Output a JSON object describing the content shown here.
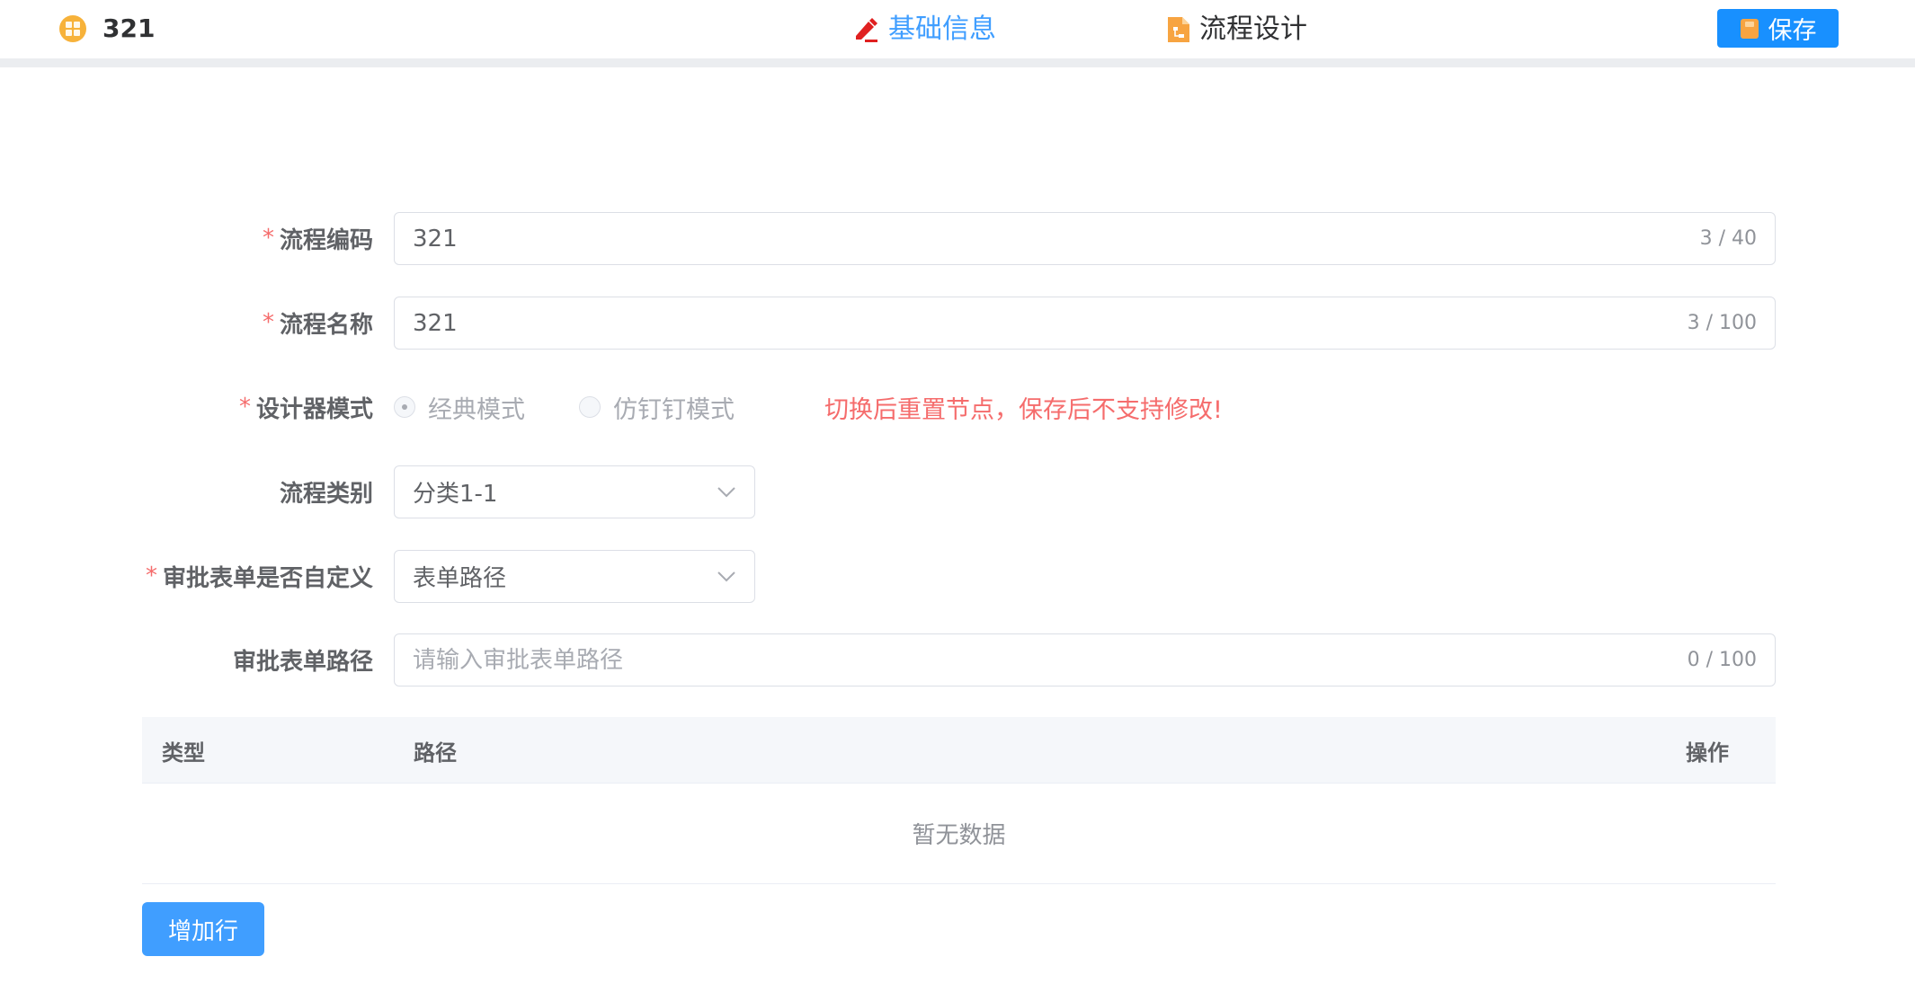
{
  "header": {
    "title": "321",
    "tabs": [
      {
        "label": "基础信息",
        "active": true,
        "icon": "edit-icon"
      },
      {
        "label": "流程设计",
        "active": false,
        "icon": "flow-doc-icon"
      }
    ],
    "save_label": "保存"
  },
  "form": {
    "code": {
      "label": "流程编码",
      "required": true,
      "value": "321",
      "counter": "3 / 40"
    },
    "name": {
      "label": "流程名称",
      "required": true,
      "value": "321",
      "counter": "3 / 100"
    },
    "mode": {
      "label": "设计器模式",
      "required": true,
      "options": [
        {
          "label": "经典模式",
          "selected": true
        },
        {
          "label": "仿钉钉模式",
          "selected": false
        }
      ],
      "warning": "切换后重置节点，保存后不支持修改!"
    },
    "category": {
      "label": "流程类别",
      "required": false,
      "value": "分类1-1"
    },
    "custom_form": {
      "label": "审批表单是否自定义",
      "required": true,
      "value": "表单路径"
    },
    "form_path": {
      "label": "审批表单路径",
      "required": false,
      "value": "",
      "placeholder": "请输入审批表单路径",
      "counter": "0 / 100"
    }
  },
  "table": {
    "headers": [
      "类型",
      "路径",
      "操作"
    ],
    "empty_text": "暂无数据",
    "add_label": "增加行"
  },
  "colors": {
    "primary": "#409eff",
    "save": "#1890ff",
    "danger": "#f56c6c",
    "logo": "#f7b23a",
    "tab_icon_active": "#e02020",
    "tab_icon_flow": "#f7a441"
  }
}
